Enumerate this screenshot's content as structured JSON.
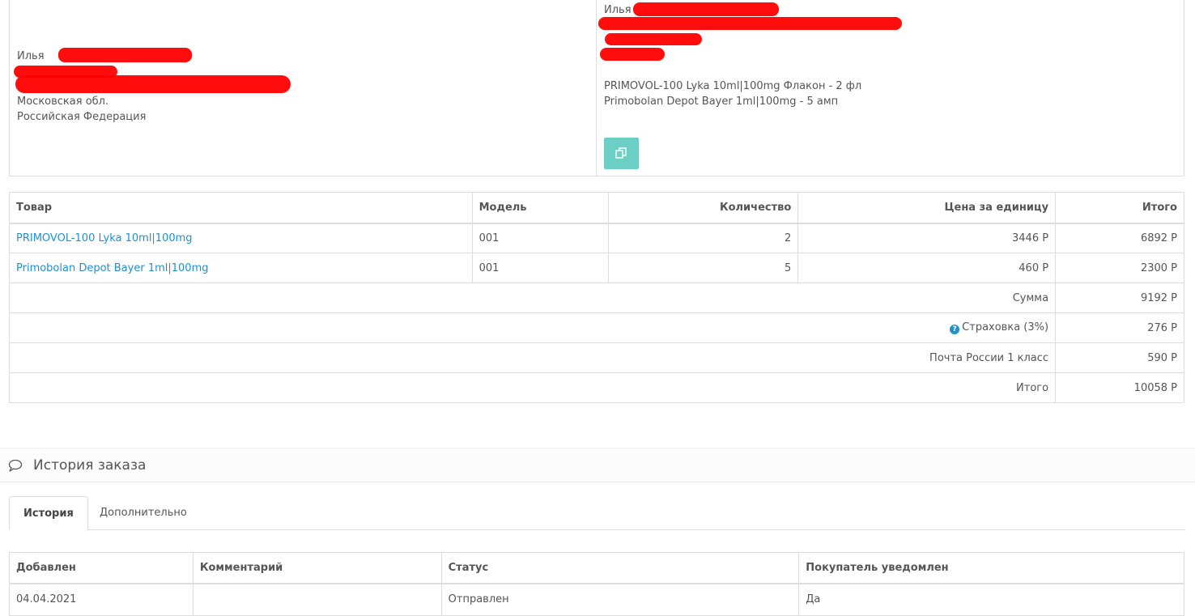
{
  "payment_address": {
    "name": "Илья",
    "region": "Московская обл.",
    "country": "Российская Федерация"
  },
  "shipping_address": {
    "name": "Илья",
    "order_lines": [
      "PRIMOVOL-100 Lyka 10ml|100mg Флакон - 2 фл",
      "Primobolan Depot Bayer 1ml|100mg - 5 амп"
    ],
    "copy_icon": "copy-icon",
    "button_color": "#6ccfc6"
  },
  "products": {
    "headers": [
      "Товар",
      "Модель",
      "Количество",
      "Цена за единицу",
      "Итого"
    ],
    "rows": [
      {
        "name": "PRIMOVOL-100 Lyka 10ml|100mg",
        "model": "001",
        "quantity": "2",
        "price": "3446 Р",
        "total": "6892 Р"
      },
      {
        "name": "Primobolan Depot Bayer 1ml|100mg",
        "model": "001",
        "quantity": "5",
        "price": "460 Р",
        "total": "2300 Р"
      }
    ],
    "totals": [
      {
        "label": "Сумма",
        "value": "9192 Р"
      },
      {
        "label": "Страховка (3%)",
        "value": "276 Р",
        "icon": "question-circle-icon"
      },
      {
        "label": "Почта России 1 класс",
        "value": "590 Р"
      },
      {
        "label": "Итого",
        "value": "10058 Р"
      }
    ],
    "link_color": "#1e91cf"
  },
  "history_panel": {
    "title": "История заказа",
    "icon": "comment-icon",
    "tabs": [
      "История",
      "Дополнительно"
    ],
    "active_tab": "История"
  },
  "history_table": {
    "headers": [
      "Добавлен",
      "Комментарий",
      "Статус",
      "Покупатель уведомлен"
    ],
    "rows": [
      {
        "date": "04.04.2021",
        "comment": "",
        "status": "Отправлен",
        "notified": "Да"
      }
    ]
  }
}
